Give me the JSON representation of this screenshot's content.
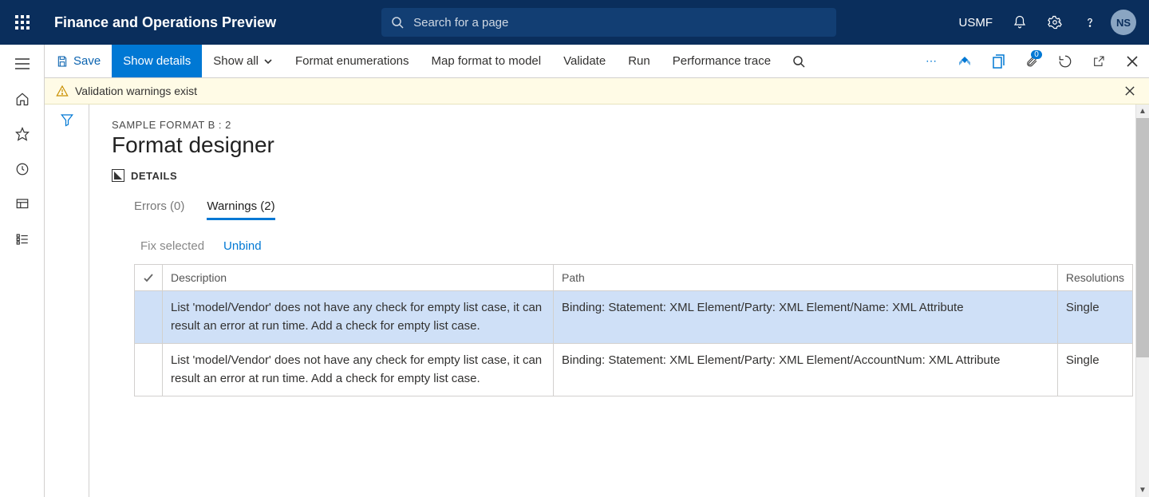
{
  "header": {
    "app_title": "Finance and Operations Preview",
    "search_placeholder": "Search for a page",
    "entity": "USMF",
    "user_initials": "NS"
  },
  "actionbar": {
    "save": "Save",
    "show_details": "Show details",
    "show_all": "Show all",
    "format_enum": "Format enumerations",
    "map_format": "Map format to model",
    "validate": "Validate",
    "run": "Run",
    "perf_trace": "Performance trace",
    "attachment_badge": "0"
  },
  "banner": {
    "text": "Validation warnings exist"
  },
  "page": {
    "breadcrumb": "SAMPLE FORMAT B : 2",
    "title": "Format designer",
    "details_label": "DETAILS"
  },
  "tabs": {
    "errors": "Errors (0)",
    "warnings": "Warnings (2)"
  },
  "toolbar": {
    "fix_selected": "Fix selected",
    "unbind": "Unbind"
  },
  "grid": {
    "headers": {
      "description": "Description",
      "path": "Path",
      "resolutions": "Resolutions"
    },
    "rows": [
      {
        "selected": true,
        "description": "List 'model/Vendor' does not have any check for empty list case, it can result an error at run time. Add a check for empty list case.",
        "path": "Binding: Statement: XML Element/Party: XML Element/Name: XML Attribute",
        "resolutions": "Single"
      },
      {
        "selected": false,
        "description": "List 'model/Vendor' does not have any check for empty list case, it can result an error at run time. Add a check for empty list case.",
        "path": "Binding: Statement: XML Element/Party: XML Element/AccountNum: XML Attribute",
        "resolutions": "Single"
      }
    ]
  }
}
